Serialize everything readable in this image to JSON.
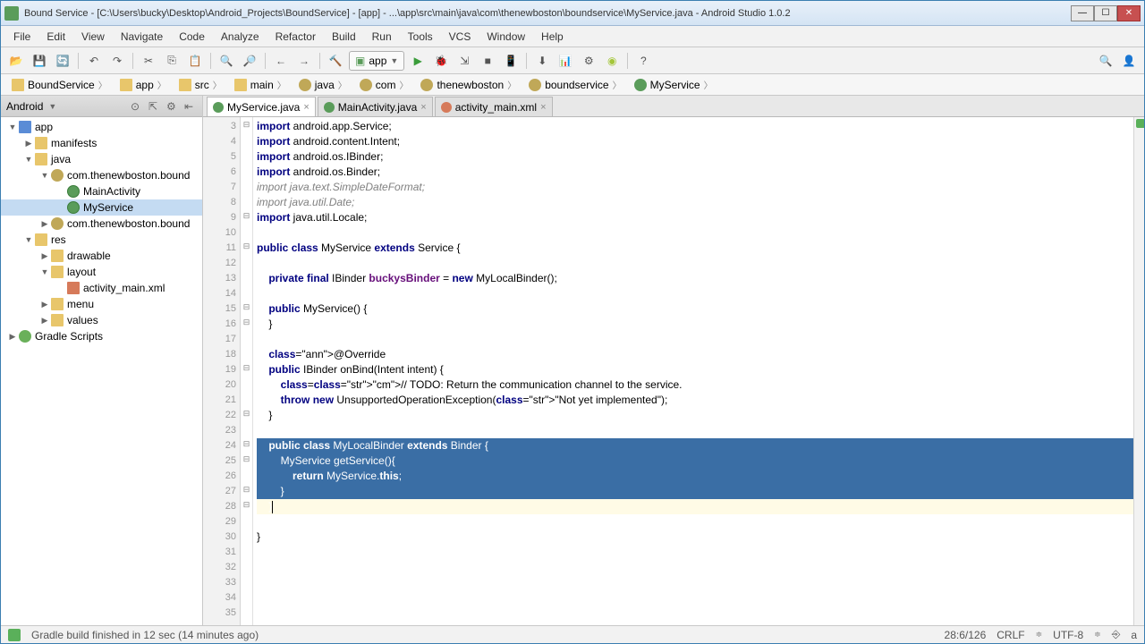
{
  "window": {
    "title": "Bound Service - [C:\\Users\\bucky\\Desktop\\Android_Projects\\BoundService] - [app] - ...\\app\\src\\main\\java\\com\\thenewboston\\boundservice\\MyService.java - Android Studio 1.0.2"
  },
  "menu": {
    "items": [
      "File",
      "Edit",
      "View",
      "Navigate",
      "Code",
      "Analyze",
      "Refactor",
      "Build",
      "Run",
      "Tools",
      "VCS",
      "Window",
      "Help"
    ]
  },
  "runconfig": {
    "label": "app"
  },
  "breadcrumbs": [
    "BoundService",
    "app",
    "src",
    "main",
    "java",
    "com",
    "thenewboston",
    "boundservice",
    "MyService"
  ],
  "project": {
    "header": "Android",
    "tree": [
      {
        "d": 0,
        "icon": "module",
        "label": "app",
        "expanded": true
      },
      {
        "d": 1,
        "icon": "folder",
        "label": "manifests",
        "expanded": false
      },
      {
        "d": 1,
        "icon": "folder",
        "label": "java",
        "expanded": true
      },
      {
        "d": 2,
        "icon": "package",
        "label": "com.thenewboston.bound",
        "expanded": true
      },
      {
        "d": 3,
        "icon": "class",
        "label": "MainActivity"
      },
      {
        "d": 3,
        "icon": "class",
        "label": "MyService",
        "selected": true
      },
      {
        "d": 2,
        "icon": "package",
        "label": "com.thenewboston.bound",
        "expanded": false
      },
      {
        "d": 1,
        "icon": "folder",
        "label": "res",
        "expanded": true
      },
      {
        "d": 2,
        "icon": "folder",
        "label": "drawable",
        "expanded": false
      },
      {
        "d": 2,
        "icon": "folder",
        "label": "layout",
        "expanded": true
      },
      {
        "d": 3,
        "icon": "xml",
        "label": "activity_main.xml"
      },
      {
        "d": 2,
        "icon": "folder",
        "label": "menu",
        "expanded": false
      },
      {
        "d": 2,
        "icon": "folder",
        "label": "values",
        "expanded": false
      },
      {
        "d": 0,
        "icon": "gradle",
        "label": "Gradle Scripts",
        "expanded": false
      }
    ]
  },
  "tabs": [
    {
      "label": "MyService.java",
      "icon": "java",
      "active": true
    },
    {
      "label": "MainActivity.java",
      "icon": "java"
    },
    {
      "label": "activity_main.xml",
      "icon": "xml"
    }
  ],
  "code": {
    "first_line": 3,
    "lines": [
      {
        "n": 3,
        "t": "import android.app.Service;",
        "f": "⊟"
      },
      {
        "n": 4,
        "t": "import android.content.Intent;"
      },
      {
        "n": 5,
        "t": "import android.os.IBinder;"
      },
      {
        "n": 6,
        "t": "import android.os.Binder;"
      },
      {
        "n": 7,
        "t": "import java.text.SimpleDateFormat;",
        "gray": true
      },
      {
        "n": 8,
        "t": "import java.util.Date;",
        "gray": true
      },
      {
        "n": 9,
        "t": "import java.util.Locale;",
        "f": "⊟"
      },
      {
        "n": 10,
        "t": ""
      },
      {
        "n": 11,
        "t": "public class MyService extends Service {",
        "f": "⊟"
      },
      {
        "n": 12,
        "t": ""
      },
      {
        "n": 13,
        "t": "    private final IBinder buckysBinder = new MyLocalBinder();"
      },
      {
        "n": 14,
        "t": ""
      },
      {
        "n": 15,
        "t": "    public MyService() {",
        "f": "⊟"
      },
      {
        "n": 16,
        "t": "    }",
        "f": "⊟"
      },
      {
        "n": 17,
        "t": ""
      },
      {
        "n": 18,
        "t": "    @Override"
      },
      {
        "n": 19,
        "t": "    public IBinder onBind(Intent intent) {",
        "f": "⊟"
      },
      {
        "n": 20,
        "t": "        // TODO: Return the communication channel to the service."
      },
      {
        "n": 21,
        "t": "        throw new UnsupportedOperationException(\"Not yet implemented\");"
      },
      {
        "n": 22,
        "t": "    }",
        "f": "⊟"
      },
      {
        "n": 23,
        "t": ""
      },
      {
        "n": 24,
        "t": "    public class MyLocalBinder extends Binder {",
        "sel": true,
        "f": "⊟"
      },
      {
        "n": 25,
        "t": "        MyService getService(){",
        "sel": true,
        "f": "⊟"
      },
      {
        "n": 26,
        "t": "            return MyService.this;",
        "sel": true
      },
      {
        "n": 27,
        "t": "        }",
        "sel": true,
        "f": "⊟"
      },
      {
        "n": 28,
        "t": "    }",
        "curr": true,
        "sel": true,
        "f": "⊟"
      },
      {
        "n": 29,
        "t": ""
      },
      {
        "n": 30,
        "t": "}"
      },
      {
        "n": 31,
        "t": ""
      },
      {
        "n": 32,
        "t": ""
      },
      {
        "n": 33,
        "t": ""
      },
      {
        "n": 34,
        "t": ""
      },
      {
        "n": 35,
        "t": ""
      }
    ]
  },
  "status": {
    "message": "Gradle build finished in 12 sec (14 minutes ago)",
    "pos": "28:6/126",
    "lineend": "CRLF",
    "encoding": "UTF-8",
    "insert": "⎆",
    "context": "a"
  }
}
